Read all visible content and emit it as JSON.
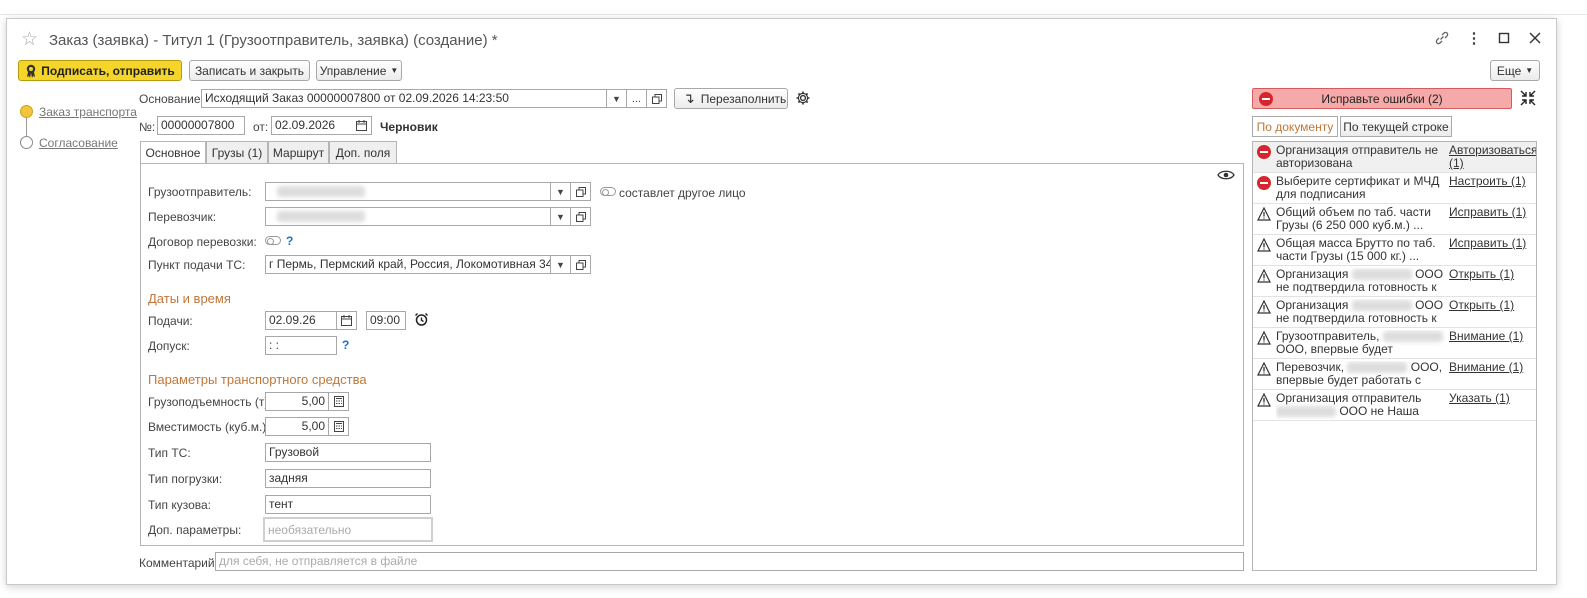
{
  "window": {
    "title": "Заказ (заявка) - Титул 1 (Грузоотправитель, заявка) (создание) *"
  },
  "toolbar": {
    "sign_send": "Подписать, отправить",
    "save_close": "Записать и закрыть",
    "manage": "Управление",
    "more": "Еще"
  },
  "steps": [
    {
      "label": "Заказ транспорта"
    },
    {
      "label": "Согласование"
    }
  ],
  "header": {
    "basis_label": "Основание:",
    "basis_value": "Исходящий Заказ 00000007800 от 02.09.2026 14:23:50",
    "refill": "Перезаполнить",
    "number_label": "№:",
    "number_value": "00000007800",
    "date_label": "от:",
    "date_value": "02.09.2026",
    "status": "Черновик"
  },
  "tabs": [
    "Основное",
    "Грузы (1)",
    "Маршрут",
    "Доп. поля"
  ],
  "main": {
    "shipper_label": "Грузоотправитель:",
    "other_person": "составлет другое лицо",
    "carrier_label": "Перевозчик:",
    "contract_label": "Договор перевозки:",
    "pickup_label": "Пункт подачи ТС:",
    "pickup_value": "г Пермь, Пермский край, Россия, Локомотивная 34",
    "dates_section": "Даты и время",
    "supply_label": "Подачи:",
    "supply_date": "02.09.26",
    "supply_time": "09:00",
    "admission_label": "Допуск:",
    "admission_value": " :  :",
    "vehicle_section": "Параметры транспортного средства",
    "capacity_label": "Грузоподъемность (т):",
    "capacity_value": "5,00",
    "volume_label": "Вместимость (куб.м.):",
    "volume_value": "5,00",
    "vtype_label": "Тип ТС:",
    "vtype_value": "Грузовой",
    "load_label": "Тип погрузки:",
    "load_value": "задняя",
    "body_label": "Тип кузова:",
    "body_value": "тент",
    "extra_label": "Доп. параметры:",
    "extra_placeholder": "необязательно",
    "question": "?"
  },
  "comment": {
    "label": "Комментарий:",
    "placeholder": "для себя, не отправляется в файле"
  },
  "errors": {
    "button": "Исправьте ошибки (2)",
    "tab_doc": "По документу",
    "tab_row": "По текущей строке",
    "items": [
      {
        "kind": "error",
        "text": "Организация отправитель не авторизована",
        "action": "Авторизоваться (1)"
      },
      {
        "kind": "error",
        "text": "Выберите сертификат и МЧД для подписания",
        "action": "Настроить (1)"
      },
      {
        "kind": "warning",
        "text": "Общий объем по таб. части Грузы (6 250 000 куб.м.) ...",
        "action": "Исправить (1)"
      },
      {
        "kind": "warning",
        "text": "Общая масса Брутто по таб. части Грузы (15 000 кг.) ...",
        "action": "Исправить (1)"
      },
      {
        "kind": "warning",
        "text_a": "Организация",
        "text_b": "ООО",
        "text_c": "не подтвердила готовность к ...",
        "action": "Открыть (1)"
      },
      {
        "kind": "warning",
        "text_a": "Организация",
        "text_b": "ООО",
        "text_c": "не подтвердила готовность к ...",
        "action": "Открыть (1)"
      },
      {
        "kind": "warning",
        "text_a": "Грузоотправитель,",
        "text_c": "ООО, впервые будет работать с",
        "action": "Внимание (1)"
      },
      {
        "kind": "warning",
        "text_a": "Перевозчик,",
        "text_b": "ООО,",
        "text_c": "впервые будет работать с ЭП...",
        "action": "Внимание (1)"
      },
      {
        "kind": "warning",
        "text_a": "Организация отправитель",
        "text_c": "ООО не Наша",
        "action": "Указать (1)"
      }
    ]
  }
}
